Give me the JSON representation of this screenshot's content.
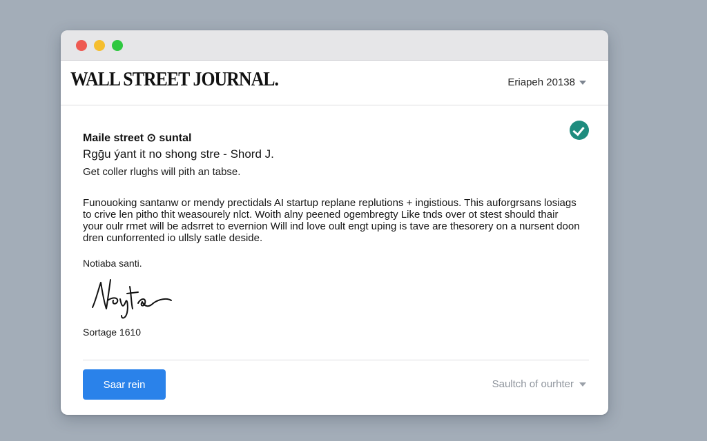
{
  "window": {
    "traffic_lights": [
      "close",
      "minimize",
      "maximize"
    ]
  },
  "header": {
    "masthead": "WALL STREET JOURNAL.",
    "edition_selector": "Eriapeh 20138"
  },
  "message": {
    "sender": "Maile street ⊙ suntal",
    "subject": "Rgḡu ýant it no shong stre - Shord J.",
    "preview": "Get coller rlughs will pith an tabse.",
    "body": "Funouoking santanw or mendy prectidals AI startup replane replutions + ingistious. This auforgrsans losiags to crive len pitho thit weasourely nlct. Woith alny peened ogembregty Like tnds over ot stest should thair your oulr rmet will be adsrret to evernion Will ind love oult engt uping is tave are thesorery on a nursent doon dren cunforrented io ullsly satle deside.",
    "signoff": "Notiaba santi.",
    "signature_text": "Neyta",
    "signature_date": "Sortage 1610",
    "verified_icon": "check-circle-icon"
  },
  "footer": {
    "primary_button": "Saar rein",
    "switch_dropdown": "Saultch of ourhter"
  },
  "colors": {
    "desktop": "#a3adb8",
    "primary_button": "#2a82ea",
    "verified_badge": "#1e8c7e"
  }
}
